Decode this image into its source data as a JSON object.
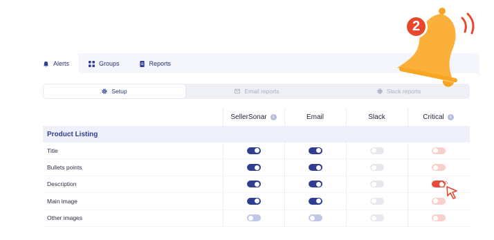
{
  "tabs": [
    {
      "label": "Alerts",
      "icon": "bell-icon",
      "active": true
    },
    {
      "label": "Groups",
      "icon": "grid-icon",
      "active": false
    },
    {
      "label": "Reports",
      "icon": "report-icon",
      "active": false
    }
  ],
  "subtabs": [
    {
      "label": "Setup",
      "icon": "gear-icon",
      "active": true
    },
    {
      "label": "Email reports",
      "icon": "mail-icon",
      "active": false
    },
    {
      "label": "Slack reports",
      "icon": "slack-icon",
      "active": false
    }
  ],
  "columns": [
    {
      "label": "SellerSonar",
      "info": true
    },
    {
      "label": "Email",
      "info": false
    },
    {
      "label": "Slack",
      "info": false
    },
    {
      "label": "Critical",
      "info": true
    }
  ],
  "section_title": "Product Listing",
  "rows": [
    {
      "label": "Title",
      "sellersonar": true,
      "email": true,
      "slack": false,
      "critical": false
    },
    {
      "label": "Bullets points",
      "sellersonar": true,
      "email": true,
      "slack": false,
      "critical": false
    },
    {
      "label": "Description",
      "sellersonar": true,
      "email": true,
      "slack": false,
      "critical": true
    },
    {
      "label": "Main image",
      "sellersonar": true,
      "email": true,
      "slack": false,
      "critical": false
    },
    {
      "label": "Other images",
      "sellersonar": false,
      "email": false,
      "slack": false,
      "critical": false
    }
  ],
  "notification_count": "2",
  "colors": {
    "primary": "#2f3d93",
    "critical": "#e74c3c",
    "bell": "#fbb03b"
  }
}
